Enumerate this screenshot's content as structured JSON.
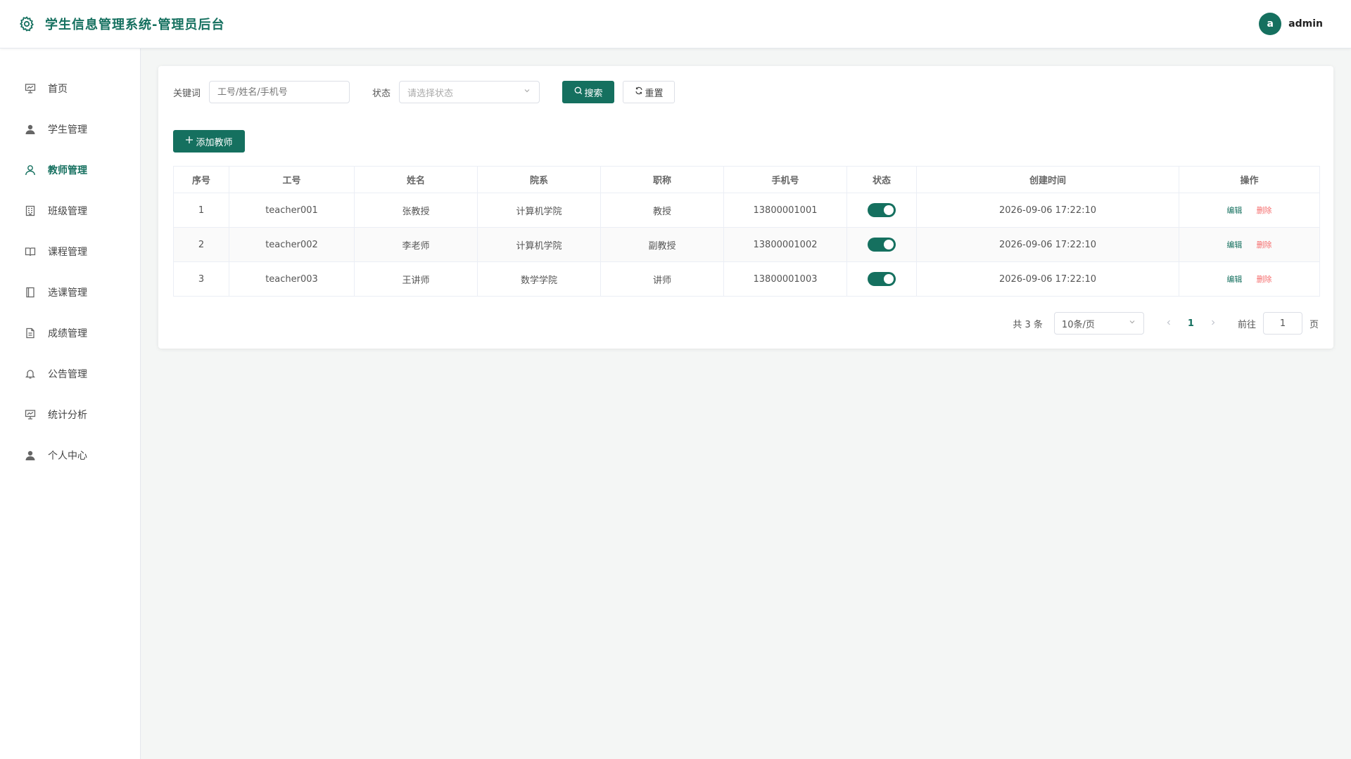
{
  "header": {
    "title": "学生信息管理系统-管理员后台",
    "avatar_letter": "a",
    "username": "admin"
  },
  "sidebar": {
    "items": [
      {
        "label": "首页",
        "icon": "dashboard-icon"
      },
      {
        "label": "学生管理",
        "icon": "user-filled-icon"
      },
      {
        "label": "教师管理",
        "icon": "user-outline-icon",
        "active": true
      },
      {
        "label": "班级管理",
        "icon": "building-icon"
      },
      {
        "label": "课程管理",
        "icon": "book-open-icon"
      },
      {
        "label": "选课管理",
        "icon": "notebook-icon"
      },
      {
        "label": "成绩管理",
        "icon": "document-icon"
      },
      {
        "label": "公告管理",
        "icon": "bell-icon"
      },
      {
        "label": "统计分析",
        "icon": "chart-board-icon"
      },
      {
        "label": "个人中心",
        "icon": "user-filled-icon"
      }
    ]
  },
  "filters": {
    "keyword_label": "关键词",
    "keyword_placeholder": "工号/姓名/手机号",
    "status_label": "状态",
    "status_placeholder": "请选择状态",
    "search_label": "搜索",
    "reset_label": "重置"
  },
  "actions": {
    "add_label": "添加教师"
  },
  "table": {
    "columns": [
      "序号",
      "工号",
      "姓名",
      "院系",
      "职称",
      "手机号",
      "状态",
      "创建时间",
      "操作"
    ],
    "rows": [
      {
        "index": "1",
        "code": "teacher001",
        "name": "张教授",
        "dept": "计算机学院",
        "title": "教授",
        "phone": "13800001001",
        "enabled": true,
        "created": "2026-09-06 17:22:10"
      },
      {
        "index": "2",
        "code": "teacher002",
        "name": "李老师",
        "dept": "计算机学院",
        "title": "副教授",
        "phone": "13800001002",
        "enabled": true,
        "created": "2026-09-06 17:22:10"
      },
      {
        "index": "3",
        "code": "teacher003",
        "name": "王讲师",
        "dept": "数学学院",
        "title": "讲师",
        "phone": "13800001003",
        "enabled": true,
        "created": "2026-09-06 17:22:10"
      }
    ],
    "edit_label": "编辑",
    "delete_label": "删除"
  },
  "pagination": {
    "total_text": "共 3 条",
    "page_size": "10条/页",
    "current_page": "1",
    "goto_label": "前往",
    "goto_value": "1",
    "page_suffix": "页"
  },
  "colors": {
    "primary": "#15705f",
    "danger": "#f56c6c"
  }
}
